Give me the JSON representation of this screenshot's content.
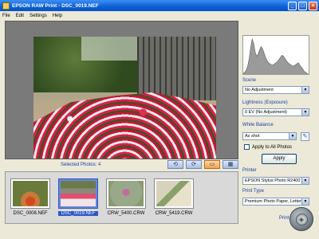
{
  "window": {
    "title": "EPSON RAW Print - DSC_0019.NEF"
  },
  "menu": [
    "File",
    "Edit",
    "Settings",
    "Help"
  ],
  "selected_photos": {
    "label": "Selected Photos:",
    "count": "4"
  },
  "thumbnails": [
    {
      "name": "DSC_0008.NEF",
      "selected": false
    },
    {
      "name": "DSC_0019.NEF",
      "selected": true
    },
    {
      "name": "CRW_5400.CRW",
      "selected": false
    },
    {
      "name": "CRW_5419.CRW",
      "selected": false
    }
  ],
  "panel": {
    "scene_label": "Scene",
    "scene_value": "No Adjustment",
    "lightness_label": "Lightness (Exposure)",
    "lightness_value": "0 EV (No Adjustment)",
    "white_balance_label": "White Balance",
    "white_balance_value": "As shot",
    "apply_all_label": "Apply to All Photos",
    "apply_label": "Apply",
    "printer_label": "Printer",
    "printer_value": "EPSON Stylus Photo R2400",
    "print_type_label": "Print Type",
    "print_type_value": "Premium Photo Paper, Letter, Bo",
    "print_label": "Print"
  },
  "histogram": [
    2,
    3,
    5,
    9,
    16,
    26,
    34,
    30,
    22,
    18,
    20,
    24,
    27,
    25,
    21,
    17,
    14,
    12,
    11,
    10,
    10,
    11,
    12,
    13,
    15,
    17,
    19,
    18,
    16,
    14,
    12,
    11,
    10,
    9,
    9,
    10,
    11,
    12,
    10,
    8,
    6,
    4,
    3,
    2,
    1,
    1
  ]
}
